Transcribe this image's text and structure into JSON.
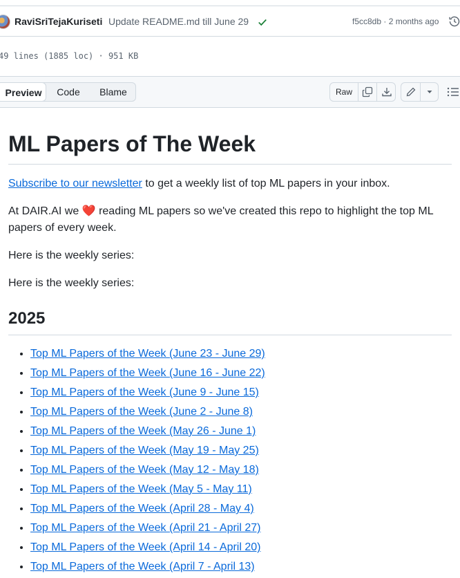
{
  "commit": {
    "author": "RaviSriTejaKuriseti",
    "message": "Update README.md till June 29",
    "status_icon": "check-icon",
    "status_color": "#1a7f37",
    "meta": "f5cc8db · 2 months ago"
  },
  "file": {
    "info": "49 lines (1885 loc) · 951 KB"
  },
  "toolbar": {
    "tabs": [
      "Preview",
      "Code",
      "Blame"
    ],
    "active_tab": "Preview",
    "raw_label": "Raw"
  },
  "readme": {
    "title": "ML Papers of The Week",
    "subscribe_link": "Subscribe to our newsletter",
    "subscribe_rest": " to get a weekly list of top ML papers in your inbox.",
    "intro_before": "At DAIR.AI we ",
    "heart": "❤️",
    "intro_after": " reading ML papers so we've created this repo to highlight the top ML papers of every week.",
    "series_line_1": "Here is the weekly series:",
    "series_line_2": "Here is the weekly series:",
    "year_heading": "2025",
    "weeks": [
      "Top ML Papers of the Week (June 23 - June 29)",
      "Top ML Papers of the Week (June 16 - June 22)",
      "Top ML Papers of the Week (June 9 - June 15)",
      "Top ML Papers of the Week (June 2 - June 8)",
      "Top ML Papers of the Week (May 26 - June 1)",
      "Top ML Papers of the Week (May 19 - May 25)",
      "Top ML Papers of the Week (May 12 - May 18)",
      "Top ML Papers of the Week (May 5 - May 11)",
      "Top ML Papers of the Week (April 28 - May 4)",
      "Top ML Papers of the Week (April 21 - April 27)",
      "Top ML Papers of the Week (April 14 - April 20)",
      "Top ML Papers of the Week (April 7 - April 13)"
    ]
  },
  "colors": {
    "link": "#0969da",
    "text": "#1f2328",
    "muted": "#59636e",
    "border": "#d1d9e0"
  }
}
